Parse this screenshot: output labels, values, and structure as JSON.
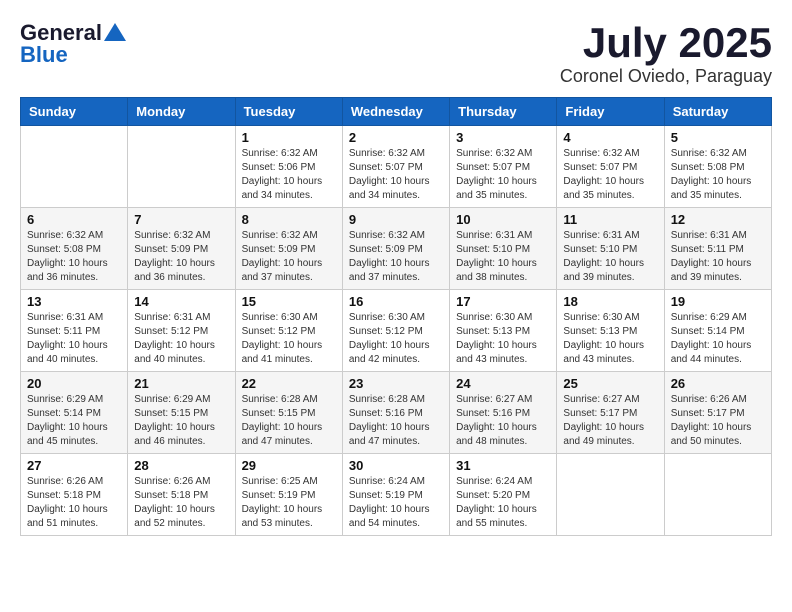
{
  "header": {
    "logo_general": "General",
    "logo_blue": "Blue",
    "month_title": "July 2025",
    "location": "Coronel Oviedo, Paraguay"
  },
  "weekdays": [
    "Sunday",
    "Monday",
    "Tuesday",
    "Wednesday",
    "Thursday",
    "Friday",
    "Saturday"
  ],
  "weeks": [
    [
      {
        "day": "",
        "info": ""
      },
      {
        "day": "",
        "info": ""
      },
      {
        "day": "1",
        "info": "Sunrise: 6:32 AM\nSunset: 5:06 PM\nDaylight: 10 hours and 34 minutes."
      },
      {
        "day": "2",
        "info": "Sunrise: 6:32 AM\nSunset: 5:07 PM\nDaylight: 10 hours and 34 minutes."
      },
      {
        "day": "3",
        "info": "Sunrise: 6:32 AM\nSunset: 5:07 PM\nDaylight: 10 hours and 35 minutes."
      },
      {
        "day": "4",
        "info": "Sunrise: 6:32 AM\nSunset: 5:07 PM\nDaylight: 10 hours and 35 minutes."
      },
      {
        "day": "5",
        "info": "Sunrise: 6:32 AM\nSunset: 5:08 PM\nDaylight: 10 hours and 35 minutes."
      }
    ],
    [
      {
        "day": "6",
        "info": "Sunrise: 6:32 AM\nSunset: 5:08 PM\nDaylight: 10 hours and 36 minutes."
      },
      {
        "day": "7",
        "info": "Sunrise: 6:32 AM\nSunset: 5:09 PM\nDaylight: 10 hours and 36 minutes."
      },
      {
        "day": "8",
        "info": "Sunrise: 6:32 AM\nSunset: 5:09 PM\nDaylight: 10 hours and 37 minutes."
      },
      {
        "day": "9",
        "info": "Sunrise: 6:32 AM\nSunset: 5:09 PM\nDaylight: 10 hours and 37 minutes."
      },
      {
        "day": "10",
        "info": "Sunrise: 6:31 AM\nSunset: 5:10 PM\nDaylight: 10 hours and 38 minutes."
      },
      {
        "day": "11",
        "info": "Sunrise: 6:31 AM\nSunset: 5:10 PM\nDaylight: 10 hours and 39 minutes."
      },
      {
        "day": "12",
        "info": "Sunrise: 6:31 AM\nSunset: 5:11 PM\nDaylight: 10 hours and 39 minutes."
      }
    ],
    [
      {
        "day": "13",
        "info": "Sunrise: 6:31 AM\nSunset: 5:11 PM\nDaylight: 10 hours and 40 minutes."
      },
      {
        "day": "14",
        "info": "Sunrise: 6:31 AM\nSunset: 5:12 PM\nDaylight: 10 hours and 40 minutes."
      },
      {
        "day": "15",
        "info": "Sunrise: 6:30 AM\nSunset: 5:12 PM\nDaylight: 10 hours and 41 minutes."
      },
      {
        "day": "16",
        "info": "Sunrise: 6:30 AM\nSunset: 5:12 PM\nDaylight: 10 hours and 42 minutes."
      },
      {
        "day": "17",
        "info": "Sunrise: 6:30 AM\nSunset: 5:13 PM\nDaylight: 10 hours and 43 minutes."
      },
      {
        "day": "18",
        "info": "Sunrise: 6:30 AM\nSunset: 5:13 PM\nDaylight: 10 hours and 43 minutes."
      },
      {
        "day": "19",
        "info": "Sunrise: 6:29 AM\nSunset: 5:14 PM\nDaylight: 10 hours and 44 minutes."
      }
    ],
    [
      {
        "day": "20",
        "info": "Sunrise: 6:29 AM\nSunset: 5:14 PM\nDaylight: 10 hours and 45 minutes."
      },
      {
        "day": "21",
        "info": "Sunrise: 6:29 AM\nSunset: 5:15 PM\nDaylight: 10 hours and 46 minutes."
      },
      {
        "day": "22",
        "info": "Sunrise: 6:28 AM\nSunset: 5:15 PM\nDaylight: 10 hours and 47 minutes."
      },
      {
        "day": "23",
        "info": "Sunrise: 6:28 AM\nSunset: 5:16 PM\nDaylight: 10 hours and 47 minutes."
      },
      {
        "day": "24",
        "info": "Sunrise: 6:27 AM\nSunset: 5:16 PM\nDaylight: 10 hours and 48 minutes."
      },
      {
        "day": "25",
        "info": "Sunrise: 6:27 AM\nSunset: 5:17 PM\nDaylight: 10 hours and 49 minutes."
      },
      {
        "day": "26",
        "info": "Sunrise: 6:26 AM\nSunset: 5:17 PM\nDaylight: 10 hours and 50 minutes."
      }
    ],
    [
      {
        "day": "27",
        "info": "Sunrise: 6:26 AM\nSunset: 5:18 PM\nDaylight: 10 hours and 51 minutes."
      },
      {
        "day": "28",
        "info": "Sunrise: 6:26 AM\nSunset: 5:18 PM\nDaylight: 10 hours and 52 minutes."
      },
      {
        "day": "29",
        "info": "Sunrise: 6:25 AM\nSunset: 5:19 PM\nDaylight: 10 hours and 53 minutes."
      },
      {
        "day": "30",
        "info": "Sunrise: 6:24 AM\nSunset: 5:19 PM\nDaylight: 10 hours and 54 minutes."
      },
      {
        "day": "31",
        "info": "Sunrise: 6:24 AM\nSunset: 5:20 PM\nDaylight: 10 hours and 55 minutes."
      },
      {
        "day": "",
        "info": ""
      },
      {
        "day": "",
        "info": ""
      }
    ]
  ]
}
